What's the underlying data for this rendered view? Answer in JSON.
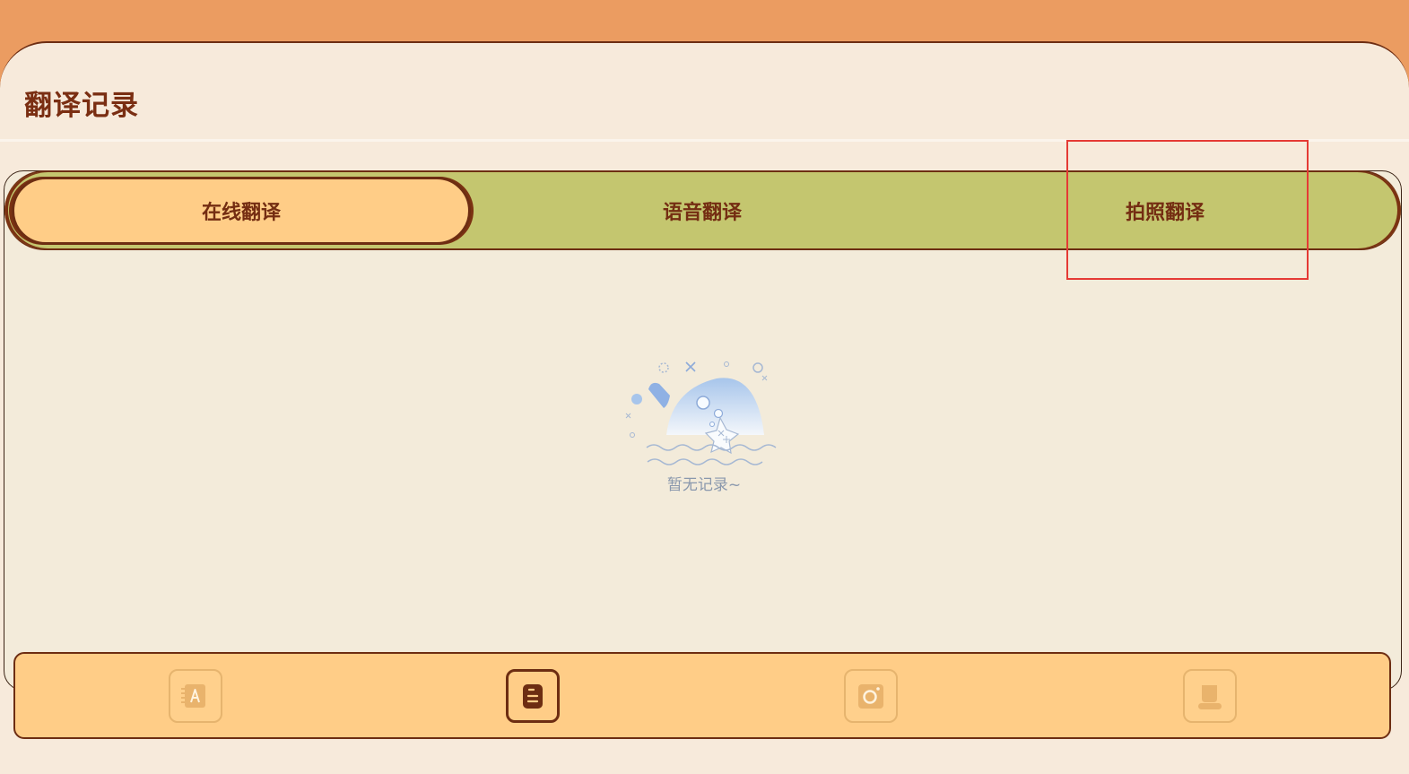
{
  "page": {
    "title": "翻译记录"
  },
  "tabs": [
    {
      "label": "在线翻译",
      "active": true
    },
    {
      "label": "语音翻译",
      "active": false
    },
    {
      "label": "拍照翻译",
      "active": false
    }
  ],
  "empty_state": {
    "message": "暂无记录~"
  },
  "bottom_nav": [
    {
      "name": "dictionary",
      "icon": "dictionary-icon",
      "active": false
    },
    {
      "name": "records",
      "icon": "records-icon",
      "active": true
    },
    {
      "name": "camera",
      "icon": "camera-icon",
      "active": false
    },
    {
      "name": "profile",
      "icon": "profile-icon",
      "active": false
    }
  ],
  "colors": {
    "header": "#eb9c61",
    "background": "#f7eadb",
    "panel": "#f3ebda",
    "tab_bar": "#c4c66f",
    "active_tab": "#ffcd87",
    "accent_dark": "#6d2d12",
    "highlight": "#e53a35",
    "empty_text": "#8a98ad"
  }
}
